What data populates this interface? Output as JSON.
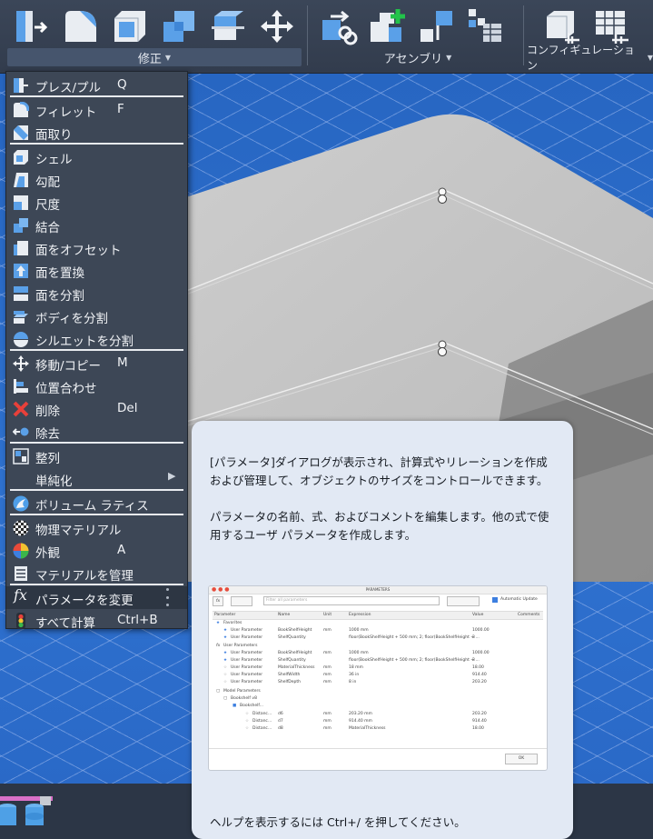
{
  "ribbon": {
    "groups": [
      {
        "id": "modify",
        "label": "修正"
      },
      {
        "id": "assemble",
        "label": "アセンブリ"
      },
      {
        "id": "configure",
        "label": "コンフィギュレーション"
      }
    ]
  },
  "menu": {
    "items": [
      {
        "id": "press-pull",
        "label": "プレス/プル",
        "shortcut": "Q"
      },
      {
        "id": "fillet",
        "label": "フィレット",
        "shortcut": "F"
      },
      {
        "id": "chamfer",
        "label": "面取り",
        "shortcut": ""
      },
      {
        "id": "shell",
        "label": "シェル",
        "shortcut": ""
      },
      {
        "id": "draft",
        "label": "勾配",
        "shortcut": ""
      },
      {
        "id": "scale",
        "label": "尺度",
        "shortcut": ""
      },
      {
        "id": "combine",
        "label": "結合",
        "shortcut": ""
      },
      {
        "id": "offset-face",
        "label": "面をオフセット",
        "shortcut": ""
      },
      {
        "id": "replace-face",
        "label": "面を置換",
        "shortcut": ""
      },
      {
        "id": "split-face",
        "label": "面を分割",
        "shortcut": ""
      },
      {
        "id": "split-body",
        "label": "ボディを分割",
        "shortcut": ""
      },
      {
        "id": "silhouette-split",
        "label": "シルエットを分割",
        "shortcut": ""
      },
      {
        "id": "move-copy",
        "label": "移動/コピー",
        "shortcut": "M"
      },
      {
        "id": "align",
        "label": "位置合わせ",
        "shortcut": ""
      },
      {
        "id": "delete",
        "label": "削除",
        "shortcut": "Del"
      },
      {
        "id": "remove",
        "label": "除去",
        "shortcut": ""
      },
      {
        "id": "arrange",
        "label": "整列",
        "shortcut": ""
      },
      {
        "id": "simplify",
        "label": "単純化",
        "shortcut": ""
      },
      {
        "id": "volumetric-lattice",
        "label": "ボリューム ラティス",
        "shortcut": ""
      },
      {
        "id": "physical-material",
        "label": "物理マテリアル",
        "shortcut": ""
      },
      {
        "id": "appearance",
        "label": "外観",
        "shortcut": "A"
      },
      {
        "id": "manage-materials",
        "label": "マテリアルを管理",
        "shortcut": ""
      },
      {
        "id": "change-parameters",
        "label": "パラメータを変更",
        "shortcut": ""
      },
      {
        "id": "compute-all",
        "label": "すべて計算",
        "shortcut": "Ctrl+B"
      }
    ]
  },
  "tooltip": {
    "paragraph1": "[パラメータ]ダイアログが表示され、計算式やリレーションを作成および管理して、オブジェクトのサイズをコントロールできます。",
    "paragraph2": "パラメータの名前、式、およびコメントを編集します。他の式で使用するユーザ パラメータを作成します。",
    "footer": "ヘルプを表示するには Ctrl+/ を押してください。",
    "preview": {
      "dialog_title": "PARAMETERS",
      "search_placeholder": "Filter all parameters",
      "automatic_update": "Automatic Update",
      "columns": [
        "Parameter",
        "Name",
        "Unit",
        "Expression",
        "Value",
        "Comments"
      ],
      "sections": {
        "favorites": "Favorites",
        "user": "User Parameters",
        "model": "Model Parameters"
      },
      "rows": [
        {
          "param": "User Parameter",
          "name": "BookShelfHeight",
          "unit": "mm",
          "expr": "1000 mm",
          "value": "1000.00"
        },
        {
          "param": "User Parameter",
          "name": "ShelfQuantity",
          "unit": "",
          "expr": "floor(BookShelfHeight + 500 mm; 2; floor(BookShelfHeight + ...",
          "value": "3"
        },
        {
          "param": "User Parameter",
          "name": "BookShelfHeight",
          "unit": "mm",
          "expr": "1000 mm",
          "value": "1000.00"
        },
        {
          "param": "User Parameter",
          "name": "ShelfQuantity",
          "unit": "",
          "expr": "floor(BookShelfHeight + 500 mm; 2; floor(BookShelfHeight + ...",
          "value": "3"
        },
        {
          "param": "User Parameter",
          "name": "MaterialThickness",
          "unit": "mm",
          "expr": "18 mm",
          "value": "18.00"
        },
        {
          "param": "User Parameter",
          "name": "ShelfWidth",
          "unit": "mm",
          "expr": "36 in",
          "value": "914.40"
        },
        {
          "param": "User Parameter",
          "name": "ShelfDepth",
          "unit": "mm",
          "expr": "8 in",
          "value": "203.20"
        }
      ],
      "tree": [
        "Bookshelf v8",
        "Bookshelf..."
      ],
      "model_rows": [
        {
          "param": "Distanc...",
          "name": "d6",
          "unit": "mm",
          "expr": "203.20 mm",
          "value": "203.20"
        },
        {
          "param": "Distanc...",
          "name": "d7",
          "unit": "mm",
          "expr": "914.40 mm",
          "value": "914.40"
        },
        {
          "param": "Distanc...",
          "name": "d8",
          "unit": "mm",
          "expr": "MaterialThickness",
          "value": "18.00"
        }
      ],
      "ok_label": "OK"
    }
  }
}
